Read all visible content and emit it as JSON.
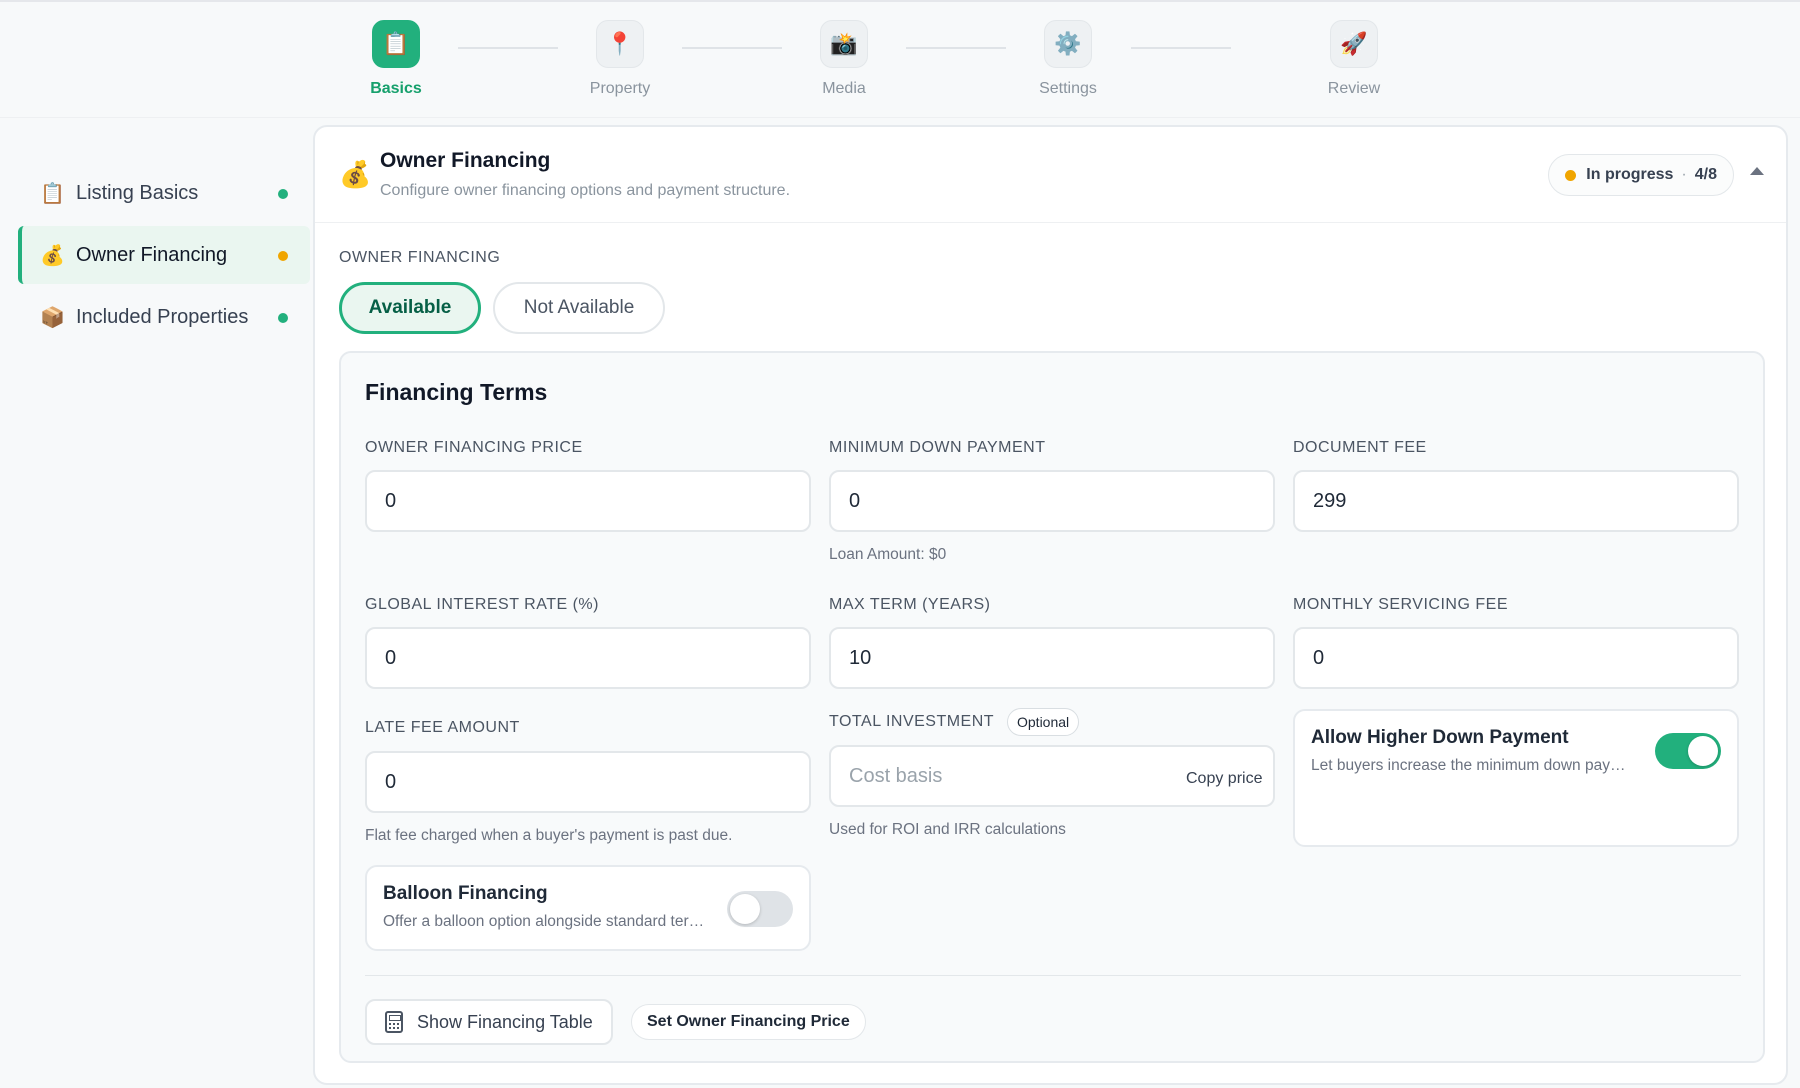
{
  "stepper": {
    "steps": [
      {
        "label": "Basics",
        "icon": "📋",
        "icon_name": "clipboard-icon"
      },
      {
        "label": "Property",
        "icon": "📍",
        "icon_name": "pin-icon"
      },
      {
        "label": "Media",
        "icon": "📸",
        "icon_name": "camera-icon"
      },
      {
        "label": "Settings",
        "icon": "⚙️",
        "icon_name": "gear-icon"
      },
      {
        "label": "Review",
        "icon": "🚀",
        "icon_name": "rocket-icon"
      }
    ],
    "active_step": "Basics"
  },
  "sidebar": {
    "items": [
      {
        "label": "Listing Basics",
        "icon": "📋",
        "status_color": "#22b07d"
      },
      {
        "label": "Owner Financing",
        "icon": "💰",
        "status_color": "#f0a500"
      },
      {
        "label": "Included Properties",
        "icon": "📦",
        "status_color": "#22b07d"
      }
    ]
  },
  "section": {
    "icon": "💰",
    "title": "Owner Financing",
    "subtitle": "Configure owner financing options and payment structure.",
    "status_text": "In progress",
    "status_sep": "·",
    "status_count": "4/8",
    "status_color": "#f0a500"
  },
  "availability": {
    "label": "OWNER FINANCING",
    "options": [
      "Available",
      "Not Available"
    ],
    "selected": "Available"
  },
  "terms": {
    "title": "Financing Terms",
    "owner_financing_price": {
      "label": "OWNER FINANCING PRICE",
      "value": "0"
    },
    "minimum_down_payment": {
      "label": "MINIMUM DOWN PAYMENT",
      "value": "0",
      "helper": "Loan Amount: $0"
    },
    "document_fee": {
      "label": "DOCUMENT FEE",
      "value": "299"
    },
    "global_interest_rate": {
      "label": "GLOBAL INTEREST RATE (%)",
      "value": "0"
    },
    "max_term": {
      "label": "MAX TERM (YEARS)",
      "value": "10"
    },
    "monthly_servicing_fee": {
      "label": "MONTHLY SERVICING FEE",
      "value": "0"
    },
    "late_fee_amount": {
      "label": "LATE FEE AMOUNT",
      "value": "0",
      "helper": "Flat fee charged when a buyer's payment is past due."
    },
    "total_investment": {
      "label": "TOTAL INVESTMENT",
      "badge": "Optional",
      "placeholder": "Cost basis",
      "action": "Copy price",
      "helper": "Used for ROI and IRR calculations"
    },
    "allow_higher_down_payment": {
      "title": "Allow Higher Down Payment",
      "description": "Let buyers increase the minimum down payment",
      "enabled": true
    },
    "balloon_financing": {
      "title": "Balloon Financing",
      "description": "Offer a balloon option alongside standard terms",
      "enabled": false
    }
  },
  "actions": {
    "show_table": "Show Financing Table",
    "set_price": "Set Owner Financing Price"
  },
  "colors": {
    "accent": "#22b07d",
    "warning": "#f0a500"
  }
}
